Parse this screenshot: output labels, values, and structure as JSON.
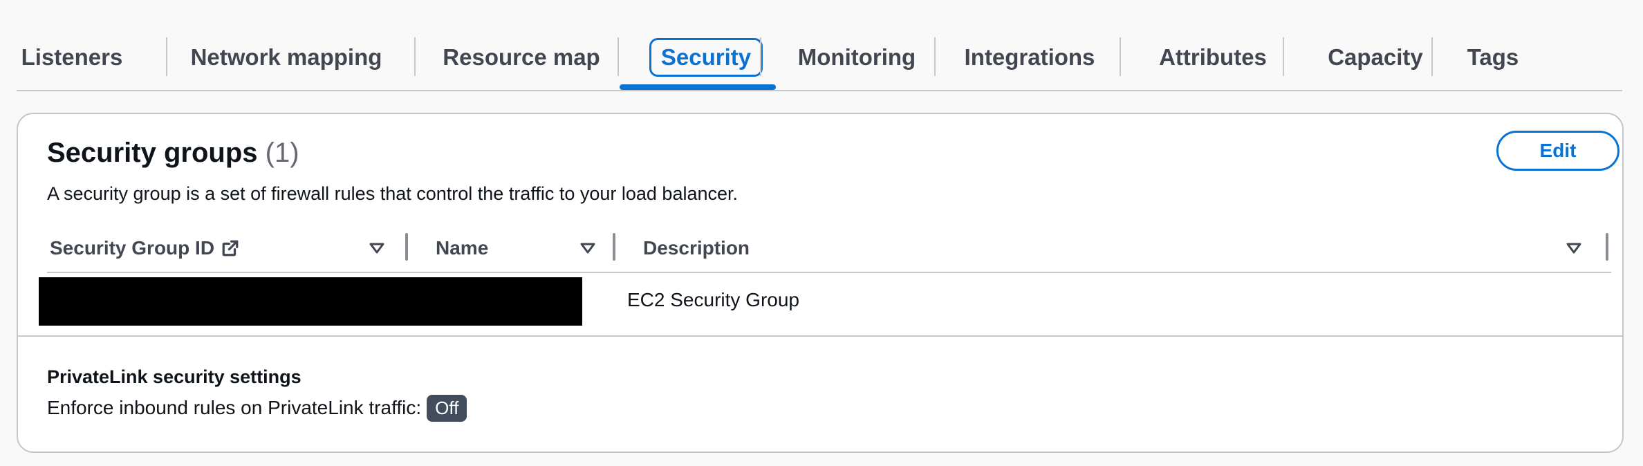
{
  "tabs": [
    {
      "label": "Listeners"
    },
    {
      "label": "Network mapping"
    },
    {
      "label": "Resource map"
    },
    {
      "label": "Security"
    },
    {
      "label": "Monitoring"
    },
    {
      "label": "Integrations"
    },
    {
      "label": "Attributes"
    },
    {
      "label": "Capacity"
    },
    {
      "label": "Tags"
    }
  ],
  "active_tab": "Security",
  "security_groups": {
    "title": "Security groups",
    "count": "(1)",
    "description": "A security group is a set of firewall rules that control the traffic to your load balancer.",
    "edit_label": "Edit",
    "columns": [
      {
        "label": "Security Group ID"
      },
      {
        "label": "Name"
      },
      {
        "label": "Description"
      }
    ],
    "rows": [
      {
        "description": "EC2 Security Group"
      }
    ]
  },
  "privatelink": {
    "title": "PrivateLink security settings",
    "label": "Enforce inbound rules on PrivateLink traffic:",
    "status": "Off"
  },
  "colors": {
    "accent": "#0972d3",
    "badge_bg": "#414d5c",
    "border": "#c6c6cd"
  },
  "icons": {
    "external_link": "external-link-icon",
    "sort": "sort-down-icon"
  }
}
